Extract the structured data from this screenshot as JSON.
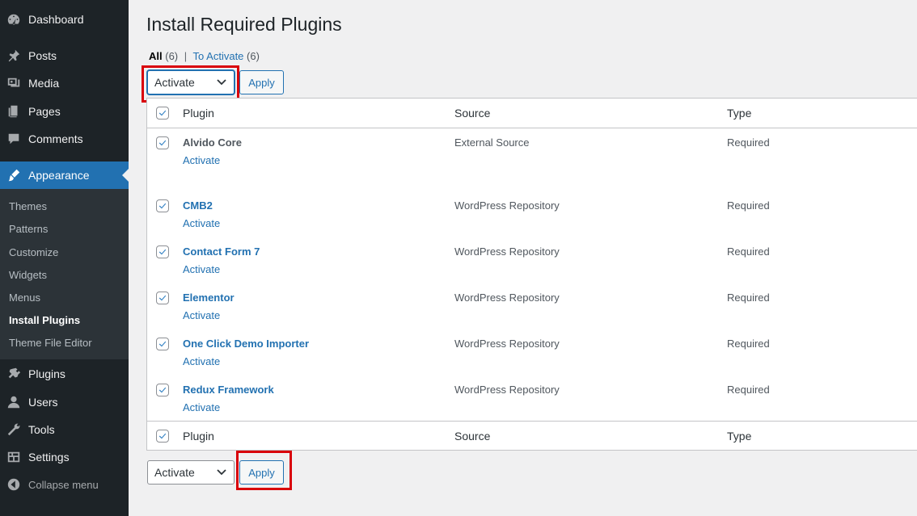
{
  "sidebar": {
    "items": [
      {
        "label": "Dashboard",
        "icon": "dashboard-icon"
      },
      {
        "label": "Posts",
        "icon": "pin-icon"
      },
      {
        "label": "Media",
        "icon": "media-icon"
      },
      {
        "label": "Pages",
        "icon": "pages-icon"
      },
      {
        "label": "Comments",
        "icon": "comment-icon"
      },
      {
        "label": "Appearance",
        "icon": "brush-icon"
      },
      {
        "label": "Plugins",
        "icon": "plug-icon"
      },
      {
        "label": "Users",
        "icon": "user-icon"
      },
      {
        "label": "Tools",
        "icon": "wrench-icon"
      },
      {
        "label": "Settings",
        "icon": "settings-icon"
      }
    ],
    "submenu": [
      "Themes",
      "Patterns",
      "Customize",
      "Widgets",
      "Menus",
      "Install Plugins",
      "Theme File Editor"
    ],
    "collapse_label": "Collapse menu"
  },
  "page": {
    "title": "Install Required Plugins",
    "filters": {
      "all_label": "All",
      "all_count": "(6)",
      "separator": "|",
      "to_activate_label": "To Activate",
      "to_activate_count": "(6)"
    }
  },
  "bulk_actions": {
    "selected": "Activate",
    "apply_label": "Apply"
  },
  "table": {
    "columns": {
      "plugin": "Plugin",
      "source": "Source",
      "type": "Type"
    },
    "rows": [
      {
        "name": "Alvido Core",
        "action": "Activate",
        "source": "External Source",
        "type": "Required"
      },
      {
        "name": "CMB2",
        "action": "Activate",
        "source": "WordPress Repository",
        "type": "Required"
      },
      {
        "name": "Contact Form 7",
        "action": "Activate",
        "source": "WordPress Repository",
        "type": "Required"
      },
      {
        "name": "Elementor",
        "action": "Activate",
        "source": "WordPress Repository",
        "type": "Required"
      },
      {
        "name": "One Click Demo Importer",
        "action": "Activate",
        "source": "WordPress Repository",
        "type": "Required"
      },
      {
        "name": "Redux Framework",
        "action": "Activate",
        "source": "WordPress Repository",
        "type": "Required"
      }
    ]
  },
  "colors": {
    "highlight": "#d9000a",
    "accent": "#2271b1",
    "sidebar_bg": "#1d2327"
  }
}
